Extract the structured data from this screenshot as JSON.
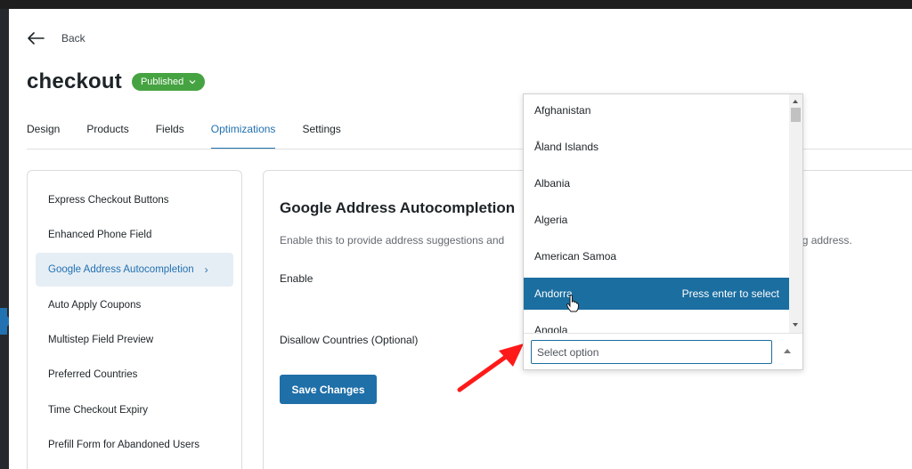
{
  "back": {
    "label": "Back"
  },
  "page": {
    "title": "checkout",
    "status": "Published"
  },
  "tabs": [
    "Design",
    "Products",
    "Fields",
    "Optimizations",
    "Settings"
  ],
  "active_tab": "Optimizations",
  "sidebar": {
    "items": [
      {
        "label": "Express Checkout Buttons"
      },
      {
        "label": "Enhanced Phone Field"
      },
      {
        "label": "Google Address Autocompletion",
        "chevron": "›"
      },
      {
        "label": "Auto Apply Coupons"
      },
      {
        "label": "Multistep Field Preview"
      },
      {
        "label": "Preferred Countries"
      },
      {
        "label": "Time Checkout Expiry"
      },
      {
        "label": "Prefill Form for Abandoned Users"
      }
    ],
    "active_item": "Google Address Autocompletion"
  },
  "panel": {
    "title": "Google Address Autocompletion",
    "description": "Enable this to provide address suggestions and",
    "description_tail": "pping address.",
    "enable_label": "Enable",
    "disallow_label": "Disallow Countries (Optional)",
    "save_label": "Save Changes"
  },
  "dropdown": {
    "options": [
      "Afghanistan",
      "Åland Islands",
      "Albania",
      "Algeria",
      "American Samoa",
      "Andorra",
      "Angola"
    ],
    "highlighted": "Andorra",
    "hint": "Press enter to select",
    "search_placeholder": "Select option"
  },
  "colors": {
    "accent": "#2271b1",
    "highlight": "#1b6ea0",
    "published": "#46a341",
    "annotation_arrow": "#ff1a1a"
  },
  "icons": [
    "arrow-left-icon",
    "chevron-down-icon",
    "chevron-right-icon",
    "hand-pointer-icon",
    "red-arrow-annotation"
  ]
}
